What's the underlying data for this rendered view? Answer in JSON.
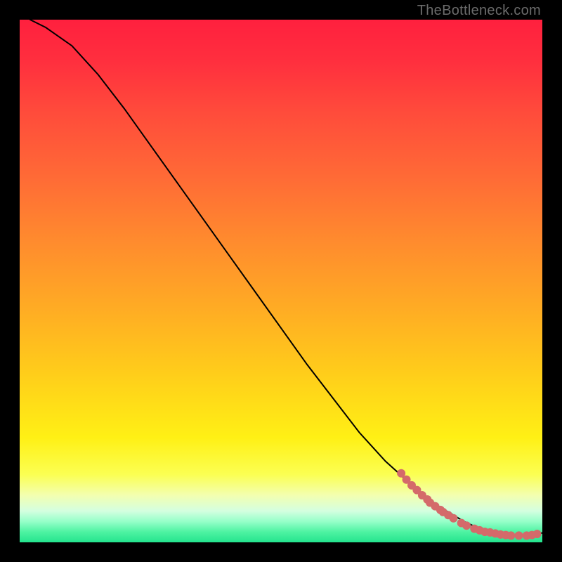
{
  "watermark": "TheBottleneck.com",
  "chart_data": {
    "type": "line",
    "title": "",
    "xlabel": "",
    "ylabel": "",
    "xlim": [
      0,
      100
    ],
    "ylim": [
      0,
      100
    ],
    "grid": false,
    "legend": null,
    "curve": {
      "x": [
        2,
        5,
        10,
        15,
        20,
        25,
        30,
        35,
        40,
        45,
        50,
        55,
        60,
        65,
        70,
        75,
        80,
        85,
        88,
        90,
        92,
        94,
        96,
        98,
        100
      ],
      "y": [
        100,
        98.5,
        95,
        89.5,
        83,
        76,
        69,
        62,
        55,
        48,
        41,
        34,
        27.5,
        21,
        15.5,
        11,
        7,
        4,
        2.6,
        2.0,
        1.6,
        1.4,
        1.3,
        1.4,
        1.8
      ]
    },
    "points": {
      "x": [
        73,
        74,
        75,
        76,
        77,
        78,
        78.5,
        79.5,
        80.5,
        81,
        82,
        83,
        84.5,
        85.5,
        87,
        88,
        89,
        90,
        91,
        92,
        93,
        94,
        95.5,
        97,
        98,
        99
      ],
      "y": [
        13.2,
        12.0,
        10.9,
        10.0,
        9.0,
        8.2,
        7.6,
        6.9,
        6.2,
        5.8,
        5.2,
        4.6,
        3.7,
        3.2,
        2.6,
        2.3,
        2.0,
        1.9,
        1.7,
        1.5,
        1.4,
        1.3,
        1.3,
        1.3,
        1.4,
        1.6
      ]
    },
    "colors": {
      "curve": "#000000",
      "points": "#d46a6a",
      "gradient_top": "#ff203e",
      "gradient_bottom": "#24e48e"
    }
  }
}
